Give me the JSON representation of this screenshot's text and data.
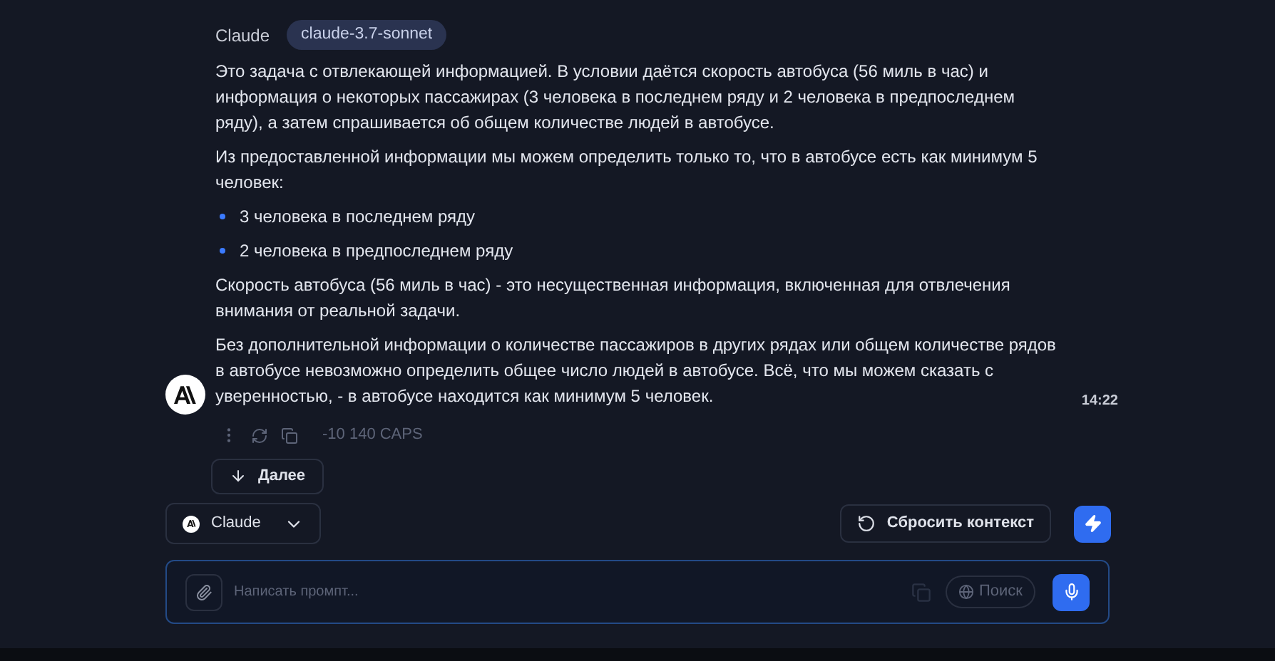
{
  "message": {
    "author": "Claude",
    "model_badge": "claude-3.7-sonnet",
    "blocks": [
      {
        "kind": "paragraph",
        "text": "Это задача с отвлекающей информацией. В условии даётся скорость автобуса (56 миль в час) и информация о некоторых пассажирах (3 человека в последнем ряду и 2 человека в предпоследнем ряду), а затем спрашивается об общем количестве людей в автобусе."
      },
      {
        "kind": "paragraph",
        "text": "Из предоставленной информации мы можем определить только то, что в автобусе есть как минимум 5 человек:"
      },
      {
        "kind": "bullet",
        "text": "3 человека в последнем ряду"
      },
      {
        "kind": "bullet",
        "text": "2 человека в предпоследнем ряду"
      },
      {
        "kind": "paragraph",
        "text": "Скорость автобуса (56 миль в час) - это несущественная информация, включенная для отвлечения внимания от реальной задачи."
      },
      {
        "kind": "paragraph",
        "text": "Без дополнительной информации о количестве пассажиров в других рядах или общем количестве рядов в автобусе невозможно определить общее число людей в автобусе. Всё, что мы можем сказать с уверенностью, - в автобусе находится как минимум 5 человек."
      }
    ],
    "time": "14:22",
    "cost": "-10 140 CAPS"
  },
  "continue_button": "Далее",
  "model_select": {
    "value": "Claude"
  },
  "reset_button": "Сбросить контекст",
  "prompt": {
    "placeholder": "Написать промпт...",
    "search_button": "Поиск"
  }
}
